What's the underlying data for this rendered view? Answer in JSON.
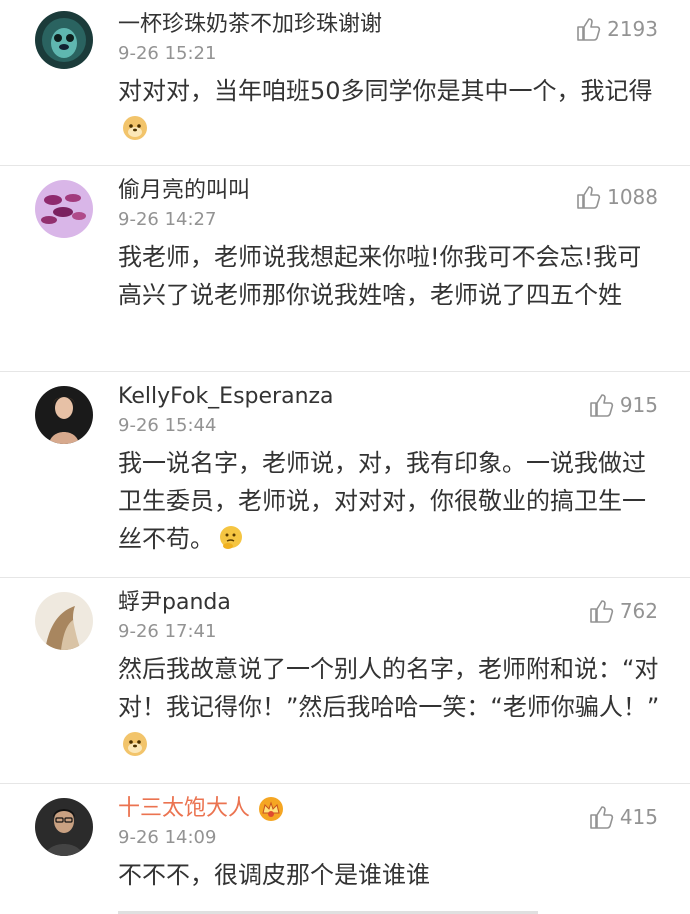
{
  "comments": [
    {
      "username": "一杯珍珠奶茶不加珍珠谢谢",
      "time": "9-26 15:21",
      "likes": "2193",
      "text": "对对对，当年咱班50多同学你是其中一个，我记得",
      "emoji": "doge-emoji"
    },
    {
      "username": "偷月亮的叫叫",
      "time": "9-26 14:27",
      "likes": "1088",
      "text": "我老师，老师说我想起来你啦!你我可不会忘!我可高兴了说老师那你说我姓啥，老师说了四五个姓"
    },
    {
      "username": "KellyFok_Esperanza",
      "time": "9-26 15:44",
      "likes": "915",
      "text": "我一说名字，老师说，对，我有印象。一说我做过卫生委员，老师说，对对对，你很敬业的搞卫生一丝不苟。",
      "emoji": "thinking-emoji"
    },
    {
      "username": "蜉尹panda",
      "time": "9-26 17:41",
      "likes": "762",
      "text": "然后我故意说了一个别人的名字，老师附和说：“对对！我记得你！”然后我哈哈一笑：“老师你骗人！”",
      "emoji": "doge-emoji"
    },
    {
      "username": "十三太饱大人",
      "time": "9-26 14:09",
      "likes": "415",
      "text": "不不不，很调皮那个是谁谁谁",
      "badge": "vip-crown-icon"
    }
  ],
  "colors": {
    "text": "#333333",
    "meta": "#939393",
    "vip_name": "#eb7350"
  }
}
